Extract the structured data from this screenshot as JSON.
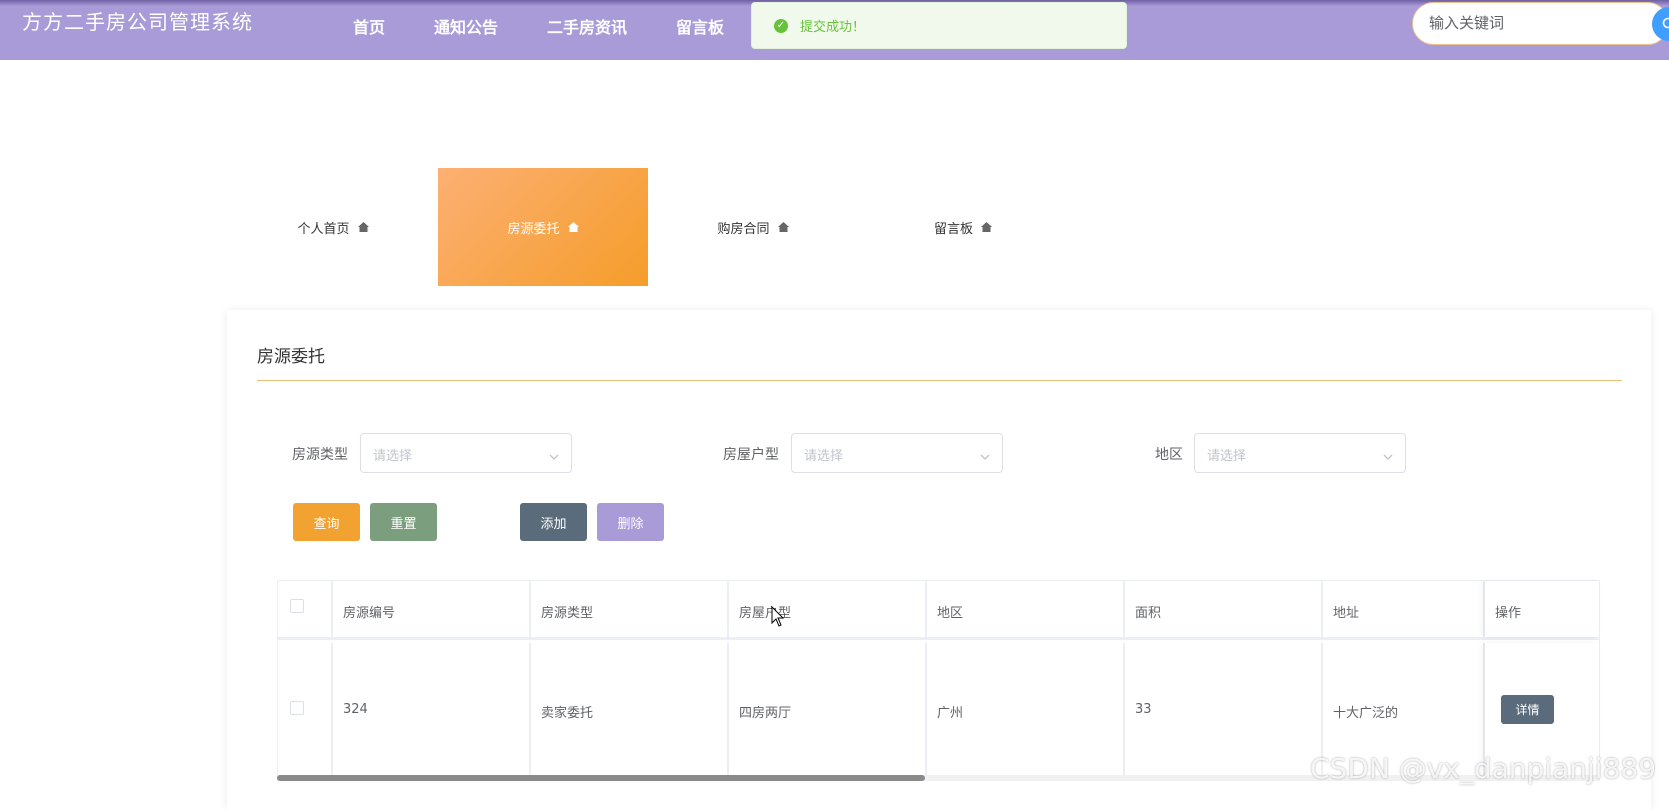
{
  "header": {
    "site_title": "方方二手房公司管理系统",
    "nav": [
      "首页",
      "通知公告",
      "二手房资讯",
      "留言板"
    ],
    "toast": "提交成功！",
    "search_placeholder": "输入关键词"
  },
  "tabs": [
    {
      "label": "个人首页",
      "active": false
    },
    {
      "label": "房源委托",
      "active": true
    },
    {
      "label": "购房合同",
      "active": false
    },
    {
      "label": "留言板",
      "active": false
    }
  ],
  "panel": {
    "title": "房源委托",
    "filters": [
      {
        "label": "房源类型",
        "placeholder": "请选择"
      },
      {
        "label": "房屋户型",
        "placeholder": "请选择"
      },
      {
        "label": "地区",
        "placeholder": "请选择"
      }
    ],
    "buttons": {
      "query": "查询",
      "reset": "重置",
      "add": "添加",
      "delete": "删除"
    },
    "button_colors": {
      "query": "#f2a230",
      "reset": "#7a9e7e",
      "add": "#5a6b7b",
      "delete": "#a99ad8"
    }
  },
  "table": {
    "headers": [
      "房源编号",
      "房源类型",
      "房屋户型",
      "地区",
      "面积",
      "地址",
      "操作"
    ],
    "rows": [
      {
        "cells": [
          "324",
          "卖家委托",
          "四房两厅",
          "广州",
          "33",
          "十大广泛的"
        ],
        "action": "详情"
      }
    ]
  },
  "watermark": "CSDN @vx_danpianji889",
  "colors": {
    "header_bg": "#a99ad8",
    "accent": "#f59d2a",
    "success": "#67c23a"
  }
}
